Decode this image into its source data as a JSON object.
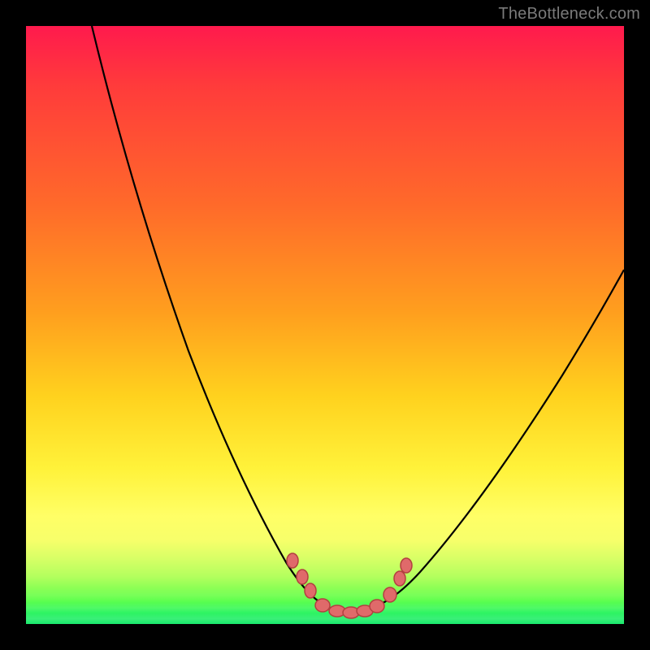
{
  "watermark": {
    "text": "TheBottleneck.com"
  },
  "colors": {
    "frame": "#000000",
    "curve_stroke": "#000000",
    "marker_fill": "#e06a6a",
    "marker_stroke": "#b34040",
    "gradient_stops": [
      "#ff1a4d",
      "#ff6a2a",
      "#ffd21e",
      "#fff23a",
      "#19e86d"
    ]
  },
  "chart_data": {
    "type": "line",
    "title": "",
    "xlabel": "",
    "ylabel": "",
    "xlim": [
      0,
      100
    ],
    "ylim": [
      0,
      100
    ],
    "grid": false,
    "legend": false,
    "note": "Bottleneck-style V-curve. x ≈ normalized ratio axis, y ≈ 100·(1 - bottleneck%). Trough ~x=54, y≈98. Clustered salmon markers near the trough.",
    "series": [
      {
        "name": "curve-left",
        "x": [
          11,
          14,
          18,
          22,
          26,
          30,
          34,
          38,
          42,
          46,
          49,
          51,
          53,
          55
        ],
        "y": [
          100,
          86,
          72,
          60,
          49,
          39,
          31,
          24,
          17,
          11,
          6,
          3,
          2,
          2
        ]
      },
      {
        "name": "curve-right",
        "x": [
          55,
          58,
          62,
          66,
          70,
          74,
          78,
          82,
          86,
          90,
          94,
          98,
          100
        ],
        "y": [
          2,
          3,
          6,
          10,
          15,
          20,
          26,
          32,
          38,
          44,
          50,
          56,
          60
        ]
      }
    ],
    "markers": {
      "name": "highlight-points",
      "shape": "circle",
      "fill": "#e06a6a",
      "stroke": "#b34040",
      "points": [
        {
          "x": 45,
          "y": 11
        },
        {
          "x": 47,
          "y": 8
        },
        {
          "x": 48,
          "y": 6
        },
        {
          "x": 50,
          "y": 3
        },
        {
          "x": 52,
          "y": 2
        },
        {
          "x": 54,
          "y": 2
        },
        {
          "x": 56,
          "y": 2
        },
        {
          "x": 58,
          "y": 3
        },
        {
          "x": 60,
          "y": 5
        },
        {
          "x": 62,
          "y": 8
        },
        {
          "x": 63,
          "y": 10
        }
      ]
    }
  }
}
